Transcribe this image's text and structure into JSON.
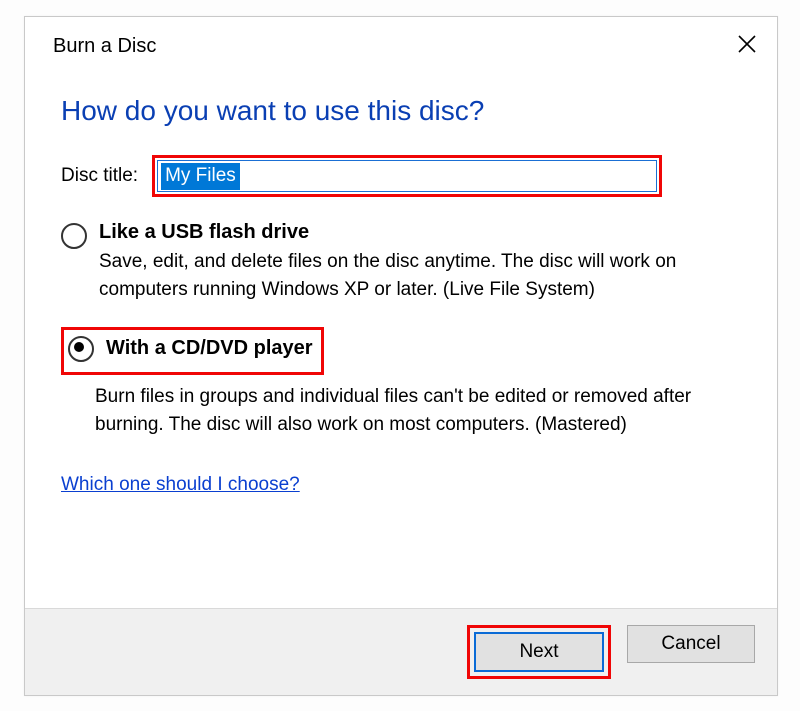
{
  "dialog": {
    "title": "Burn a Disc",
    "heading": "How do you want to use this disc?",
    "disc_title_label": "Disc title:",
    "disc_title_value": "My Files",
    "options": [
      {
        "title": "Like a USB flash drive",
        "desc": "Save, edit, and delete files on the disc anytime. The disc will work on computers running Windows XP or later. (Live File System)",
        "checked": false
      },
      {
        "title": "With a CD/DVD player",
        "desc": "Burn files in groups and individual files can't be edited or removed after burning. The disc will also work on most computers. (Mastered)",
        "checked": true
      }
    ],
    "help_link": "Which one should I choose?",
    "buttons": {
      "next": "Next",
      "cancel": "Cancel"
    }
  }
}
